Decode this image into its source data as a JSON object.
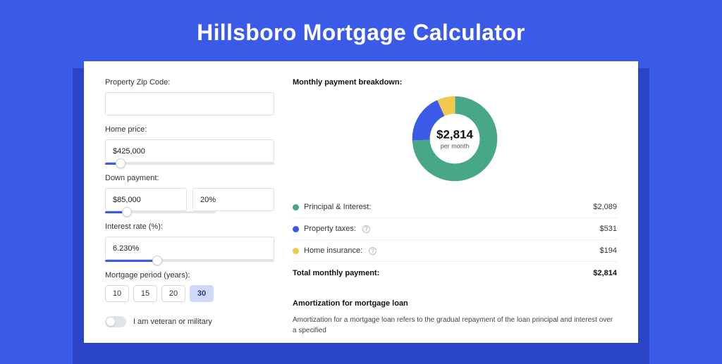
{
  "title": "Hillsboro Mortgage Calculator",
  "form": {
    "zip_label": "Property Zip Code:",
    "zip_value": "",
    "home_price_label": "Home price:",
    "home_price_value": "$425,000",
    "home_price_slider_pct": 9,
    "down_payment_label": "Down payment:",
    "down_payment_value": "$85,000",
    "down_payment_pct": "20%",
    "down_payment_slider_pct": 20,
    "interest_label": "Interest rate (%):",
    "interest_value": "6.230%",
    "interest_slider_pct": 31,
    "period_label": "Mortgage period (years):",
    "period_options": [
      "10",
      "15",
      "20",
      "30"
    ],
    "period_selected": "30",
    "veteran_label": "I am veteran or military",
    "veteran_on": false
  },
  "breakdown": {
    "section_title": "Monthly payment breakdown:",
    "total_amount": "$2,814",
    "total_sub": "per month",
    "rows": [
      {
        "label": "Principal & Interest:",
        "color": "#48a789",
        "value": "$2,089",
        "info": false
      },
      {
        "label": "Property taxes:",
        "color": "#3a5ae8",
        "value": "$531",
        "info": true
      },
      {
        "label": "Home insurance:",
        "color": "#f2c94c",
        "value": "$194",
        "info": true
      }
    ],
    "total_label": "Total monthly payment:"
  },
  "chart_data": {
    "type": "pie",
    "title": "Monthly payment breakdown",
    "series": [
      {
        "name": "Principal & Interest",
        "value": 2089,
        "color": "#48a789"
      },
      {
        "name": "Property taxes",
        "value": 531,
        "color": "#3a5ae8"
      },
      {
        "name": "Home insurance",
        "value": 194,
        "color": "#f2c94c"
      }
    ],
    "total": 2814,
    "unit": "$ per month"
  },
  "amortization": {
    "title": "Amortization for mortgage loan",
    "text": "Amortization for a mortgage loan refers to the gradual repayment of the loan principal and interest over a specified"
  }
}
